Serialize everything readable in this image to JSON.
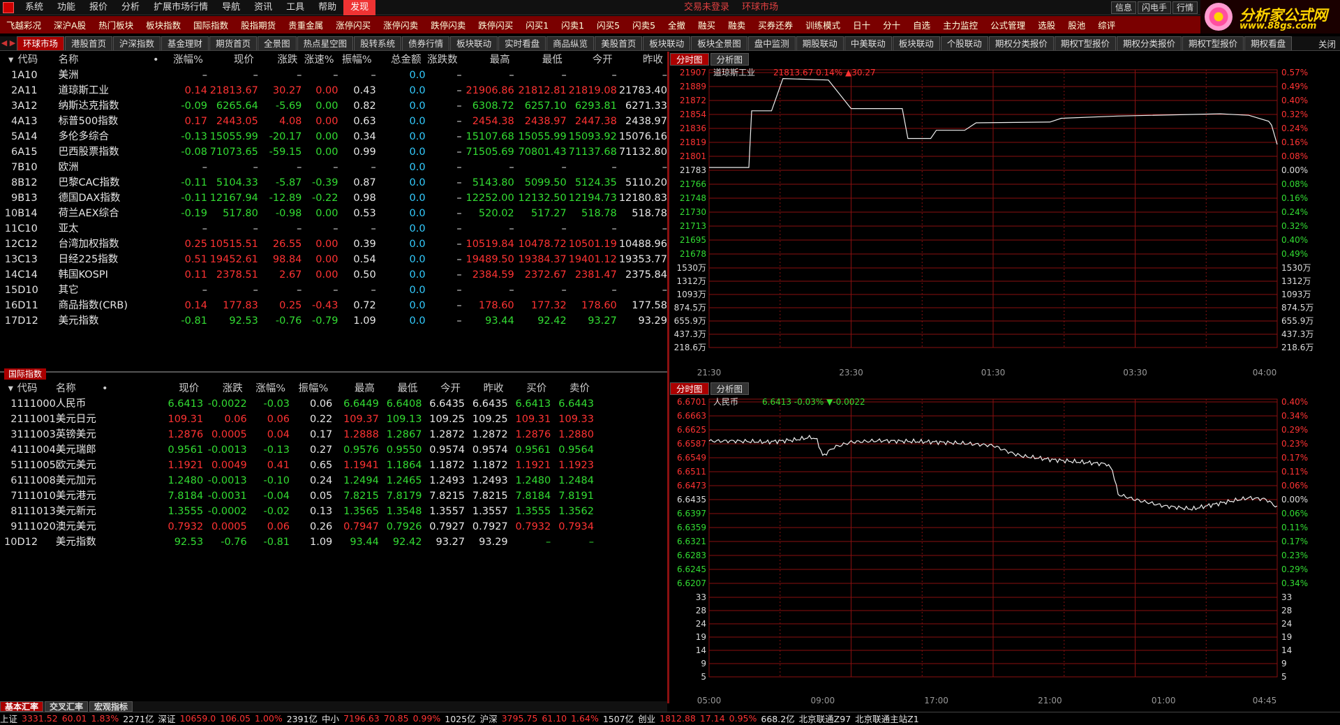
{
  "menu": {
    "items": [
      "系统",
      "功能",
      "报价",
      "分析",
      "扩展市场行情",
      "导航",
      "资讯",
      "工具",
      "帮助",
      "发现"
    ],
    "active_index": 9,
    "center": [
      "交易未登录",
      "环球市场"
    ]
  },
  "window_buttons": [
    "信息",
    "闪电手",
    "行情"
  ],
  "brand": {
    "name": "分析家公式网",
    "url": "www.88gs.com"
  },
  "toolbar": [
    "飞越彩况",
    "深沪A股",
    "热门板块",
    "板块指数",
    "国际指数",
    "股指期货",
    "贵重金属",
    "涨停闪买",
    "涨停闪卖",
    "跌停闪卖",
    "跌停闪买",
    "闪买1",
    "闪卖1",
    "闪买5",
    "闪卖5",
    "全撤",
    "融买",
    "融卖",
    "买券还券",
    "训练模式",
    "日十",
    "分十",
    "自选",
    "主力监控",
    "公式管理",
    "选股",
    "股池",
    "综评"
  ],
  "tabs": {
    "items": [
      "环球市场",
      "港股首页",
      "沪深指数",
      "基金理财",
      "期货首页",
      "全景图",
      "热点星空图",
      "股转系统",
      "债券行情",
      "板块联动",
      "实时看盘",
      "商品纵览",
      "美股首页",
      "板块联动",
      "板块全景图",
      "盘中监测",
      "期股联动",
      "中美联动",
      "板块联动",
      "个股联动",
      "期权分类报价",
      "期权T型报价",
      "期权分类报价",
      "期权T型报价",
      "期权看盘"
    ],
    "active_index": 0,
    "close": "关闭"
  },
  "top_table": {
    "headers": [
      "代码",
      "名称",
      "•",
      "涨幅%",
      "现价",
      "涨跌",
      "涨速%",
      "振幅%",
      "总金额",
      "涨跌数",
      "最高",
      "最低",
      "今开",
      "昨收"
    ],
    "rows": [
      [
        "1",
        "A10",
        "美洲",
        "–",
        "–",
        "–",
        "–",
        "–",
        "0.0",
        "–",
        "–",
        "–",
        "–",
        "–",
        "n"
      ],
      [
        "2",
        "A11",
        "道琼斯工业",
        "0.14",
        "21813.67",
        "30.27",
        "0.00",
        "0.43",
        "0.0",
        "–",
        "21906.86",
        "21812.81",
        "21819.08",
        "21783.40",
        "r"
      ],
      [
        "3",
        "A12",
        "纳斯达克指数",
        "-0.09",
        "6265.64",
        "-5.69",
        "0.00",
        "0.82",
        "0.0",
        "–",
        "6308.72",
        "6257.10",
        "6293.81",
        "6271.33",
        "g"
      ],
      [
        "4",
        "A13",
        "标普500指数",
        "0.17",
        "2443.05",
        "4.08",
        "0.00",
        "0.63",
        "0.0",
        "–",
        "2454.38",
        "2438.97",
        "2447.38",
        "2438.97",
        "r"
      ],
      [
        "5",
        "A14",
        "多伦多综合",
        "-0.13",
        "15055.99",
        "-20.17",
        "0.00",
        "0.34",
        "0.0",
        "–",
        "15107.68",
        "15055.99",
        "15093.92",
        "15076.16",
        "g"
      ],
      [
        "6",
        "A15",
        "巴西股票指数",
        "-0.08",
        "71073.65",
        "-59.15",
        "0.00",
        "0.99",
        "0.0",
        "–",
        "71505.69",
        "70801.43",
        "71137.68",
        "71132.80",
        "g"
      ],
      [
        "7",
        "B10",
        "欧洲",
        "–",
        "–",
        "–",
        "–",
        "–",
        "0.0",
        "–",
        "–",
        "–",
        "–",
        "–",
        "n"
      ],
      [
        "8",
        "B12",
        "巴黎CAC指数",
        "-0.11",
        "5104.33",
        "-5.87",
        "-0.39",
        "0.87",
        "0.0",
        "–",
        "5143.80",
        "5099.50",
        "5124.35",
        "5110.20",
        "g"
      ],
      [
        "9",
        "B13",
        "德国DAX指数",
        "-0.11",
        "12167.94",
        "-12.89",
        "-0.22",
        "0.98",
        "0.0",
        "–",
        "12252.00",
        "12132.50",
        "12194.73",
        "12180.83",
        "g"
      ],
      [
        "10",
        "B14",
        "荷兰AEX综合",
        "-0.19",
        "517.80",
        "-0.98",
        "0.00",
        "0.53",
        "0.0",
        "–",
        "520.02",
        "517.27",
        "518.78",
        "518.78",
        "g"
      ],
      [
        "11",
        "C10",
        "亚太",
        "–",
        "–",
        "–",
        "–",
        "–",
        "0.0",
        "–",
        "–",
        "–",
        "–",
        "–",
        "n"
      ],
      [
        "12",
        "C12",
        "台湾加权指数",
        "0.25",
        "10515.51",
        "26.55",
        "0.00",
        "0.39",
        "0.0",
        "–",
        "10519.84",
        "10478.72",
        "10501.19",
        "10488.96",
        "r"
      ],
      [
        "13",
        "C13",
        "日经225指数",
        "0.51",
        "19452.61",
        "98.84",
        "0.00",
        "0.54",
        "0.0",
        "–",
        "19489.50",
        "19384.37",
        "19401.12",
        "19353.77",
        "r"
      ],
      [
        "14",
        "C14",
        "韩国KOSPI",
        "0.11",
        "2378.51",
        "2.67",
        "0.00",
        "0.50",
        "0.0",
        "–",
        "2384.59",
        "2372.67",
        "2381.47",
        "2375.84",
        "r"
      ],
      [
        "15",
        "D10",
        "其它",
        "–",
        "–",
        "–",
        "–",
        "–",
        "0.0",
        "–",
        "–",
        "–",
        "–",
        "–",
        "n"
      ],
      [
        "16",
        "D11",
        "商品指数(CRB)",
        "0.14",
        "177.83",
        "0.25",
        "-0.43",
        "0.72",
        "0.0",
        "–",
        "178.60",
        "177.32",
        "178.60",
        "177.58",
        "r"
      ],
      [
        "17",
        "D12",
        "美元指数",
        "-0.81",
        "92.53",
        "-0.76",
        "-0.79",
        "1.09",
        "0.0",
        "–",
        "93.44",
        "92.42",
        "93.27",
        "93.29",
        "g"
      ]
    ]
  },
  "bottom_label": "国际指数",
  "bottom_table": {
    "headers": [
      "代码",
      "名称",
      "•",
      "现价",
      "涨跌",
      "涨幅%",
      "振幅%",
      "最高",
      "最低",
      "今开",
      "昨收",
      "买价",
      "卖价"
    ],
    "rows": [
      [
        "1",
        "111000",
        "人民币",
        "6.6413",
        "-0.0022",
        "-0.03",
        "0.06",
        "6.6449",
        "6.6408",
        "6.6435",
        "6.6435",
        "6.6413",
        "6.6443",
        "g"
      ],
      [
        "2",
        "111001",
        "美元日元",
        "109.31",
        "0.06",
        "0.06",
        "0.22",
        "109.37",
        "109.13",
        "109.25",
        "109.25",
        "109.31",
        "109.33",
        "r"
      ],
      [
        "3",
        "111003",
        "英镑美元",
        "1.2876",
        "0.0005",
        "0.04",
        "0.17",
        "1.2888",
        "1.2867",
        "1.2872",
        "1.2872",
        "1.2876",
        "1.2880",
        "r"
      ],
      [
        "4",
        "111004",
        "美元瑞郎",
        "0.9561",
        "-0.0013",
        "-0.13",
        "0.27",
        "0.9576",
        "0.9550",
        "0.9574",
        "0.9574",
        "0.9561",
        "0.9564",
        "g"
      ],
      [
        "5",
        "111005",
        "欧元美元",
        "1.1921",
        "0.0049",
        "0.41",
        "0.65",
        "1.1941",
        "1.1864",
        "1.1872",
        "1.1872",
        "1.1921",
        "1.1923",
        "r"
      ],
      [
        "6",
        "111008",
        "美元加元",
        "1.2480",
        "-0.0013",
        "-0.10",
        "0.24",
        "1.2494",
        "1.2465",
        "1.2493",
        "1.2493",
        "1.2480",
        "1.2484",
        "g"
      ],
      [
        "7",
        "111010",
        "美元港元",
        "7.8184",
        "-0.0031",
        "-0.04",
        "0.05",
        "7.8215",
        "7.8179",
        "7.8215",
        "7.8215",
        "7.8184",
        "7.8191",
        "g"
      ],
      [
        "8",
        "111013",
        "美元新元",
        "1.3555",
        "-0.0002",
        "-0.02",
        "0.13",
        "1.3565",
        "1.3548",
        "1.3557",
        "1.3557",
        "1.3555",
        "1.3562",
        "g"
      ],
      [
        "9",
        "111020",
        "澳元美元",
        "0.7932",
        "0.0005",
        "0.06",
        "0.26",
        "0.7947",
        "0.7926",
        "0.7927",
        "0.7927",
        "0.7932",
        "0.7934",
        "r"
      ],
      [
        "10",
        "D12",
        "美元指数",
        "92.53",
        "-0.76",
        "-0.81",
        "1.09",
        "93.44",
        "92.42",
        "93.27",
        "93.29",
        "–",
        "–",
        "g"
      ]
    ]
  },
  "bottom_tabs": [
    "基本汇率",
    "交叉汇率",
    "宏观指标"
  ],
  "statusbar": [
    {
      "t": "上证",
      "c": "w"
    },
    {
      "t": "3331.52",
      "c": "r"
    },
    {
      "t": "60.01",
      "c": "r"
    },
    {
      "t": "1.83%",
      "c": "r"
    },
    {
      "t": "2271亿",
      "c": "w"
    },
    {
      "t": "深证",
      "c": "w"
    },
    {
      "t": "10659.0",
      "c": "r"
    },
    {
      "t": "106.05",
      "c": "r"
    },
    {
      "t": "1.00%",
      "c": "r"
    },
    {
      "t": "2391亿",
      "c": "w"
    },
    {
      "t": "中小",
      "c": "w"
    },
    {
      "t": "7196.63",
      "c": "r"
    },
    {
      "t": "70.85",
      "c": "r"
    },
    {
      "t": "0.99%",
      "c": "r"
    },
    {
      "t": "1025亿",
      "c": "w"
    },
    {
      "t": "沪深",
      "c": "w"
    },
    {
      "t": "3795.75",
      "c": "r"
    },
    {
      "t": "61.10",
      "c": "r"
    },
    {
      "t": "1.64%",
      "c": "r"
    },
    {
      "t": "1507亿",
      "c": "w"
    },
    {
      "t": "创业",
      "c": "w"
    },
    {
      "t": "1812.88",
      "c": "r"
    },
    {
      "t": "17.14",
      "c": "r"
    },
    {
      "t": "0.95%",
      "c": "r"
    },
    {
      "t": "668.2亿",
      "c": "w"
    },
    {
      "t": "北京联通Z97",
      "c": "w"
    },
    {
      "t": "北京联通主站Z1",
      "c": "w"
    }
  ],
  "chart_tabs": [
    "分时图",
    "分析图"
  ],
  "chart_data": [
    {
      "type": "line",
      "title": "道琼斯工业",
      "info_price": "21813.67",
      "info_pct": "0.14%",
      "info_chg": "▲30.27",
      "ylabels": [
        "21907",
        "21889",
        "21872",
        "21854",
        "21836",
        "21819",
        "21801",
        "21783",
        "21766",
        "21748",
        "21730",
        "21713",
        "21695",
        "21678"
      ],
      "pctlabels": [
        "0.57%",
        "0.49%",
        "0.40%",
        "0.32%",
        "0.24%",
        "0.16%",
        "0.08%",
        "0.00%",
        "0.08%",
        "0.16%",
        "0.24%",
        "0.32%",
        "0.40%",
        "0.49%"
      ],
      "vollabels": [
        "1530万",
        "1312万",
        "1093万",
        "874.5万",
        "655.9万",
        "437.3万",
        "218.6万"
      ],
      "xlabels": [
        "21:30",
        "23:30",
        "01:30",
        "03:30",
        "04:00"
      ],
      "base": 21783.4,
      "ymin": 21668,
      "ymax": 21910,
      "x": [
        0,
        0.07,
        0.075,
        0.11,
        0.13,
        0.21,
        0.25,
        0.34,
        0.35,
        0.39,
        0.4,
        0.45,
        0.47,
        0.6,
        0.62,
        0.72,
        0.9,
        0.95,
        0.985,
        0.99,
        1.0
      ],
      "y": [
        21783.4,
        21783.4,
        21859,
        21859,
        21902,
        21900,
        21862,
        21862,
        21822,
        21822,
        21833,
        21833,
        21843,
        21844,
        21849,
        21852,
        21855,
        21853,
        21845,
        21840,
        21814
      ]
    },
    {
      "type": "line",
      "title": "人民币",
      "info_price": "6.6413",
      "info_pct": "-0.03%",
      "info_chg": "▼-0.0022",
      "ylabels": [
        "6.6701",
        "6.6663",
        "6.6625",
        "6.6587",
        "6.6549",
        "6.6511",
        "6.6473",
        "6.6435",
        "6.6397",
        "6.6359",
        "6.6321",
        "6.6283",
        "6.6245",
        "6.6207"
      ],
      "pctlabels": [
        "0.40%",
        "0.34%",
        "0.29%",
        "0.23%",
        "0.17%",
        "0.11%",
        "0.06%",
        "0.00%",
        "0.06%",
        "0.11%",
        "0.17%",
        "0.23%",
        "0.29%",
        "0.34%"
      ],
      "vollabels": [
        "33",
        "28",
        "24",
        "19",
        "14",
        "9",
        "5"
      ],
      "xlabels": [
        "05:00",
        "09:00",
        "17:00",
        "21:00",
        "01:00",
        "04:45"
      ],
      "base": 6.6435,
      "ymin": 6.6195,
      "ymax": 6.6715,
      "x": [
        0,
        0.05,
        0.1,
        0.15,
        0.18,
        0.19,
        0.2,
        0.22,
        0.25,
        0.3,
        0.35,
        0.4,
        0.45,
        0.5,
        0.53,
        0.55,
        0.6,
        0.65,
        0.7,
        0.71,
        0.72,
        0.75,
        0.8,
        0.85,
        0.9,
        0.95,
        0.98,
        1.0
      ],
      "y": [
        6.6603,
        6.6603,
        6.66,
        6.6606,
        6.6614,
        6.6606,
        6.656,
        6.6585,
        6.66,
        6.6604,
        6.6602,
        6.66,
        6.6596,
        6.659,
        6.657,
        6.656,
        6.655,
        6.6543,
        6.6537,
        6.652,
        6.645,
        6.6435,
        6.6417,
        6.6408,
        6.6425,
        6.644,
        6.6436,
        6.6413
      ]
    }
  ]
}
